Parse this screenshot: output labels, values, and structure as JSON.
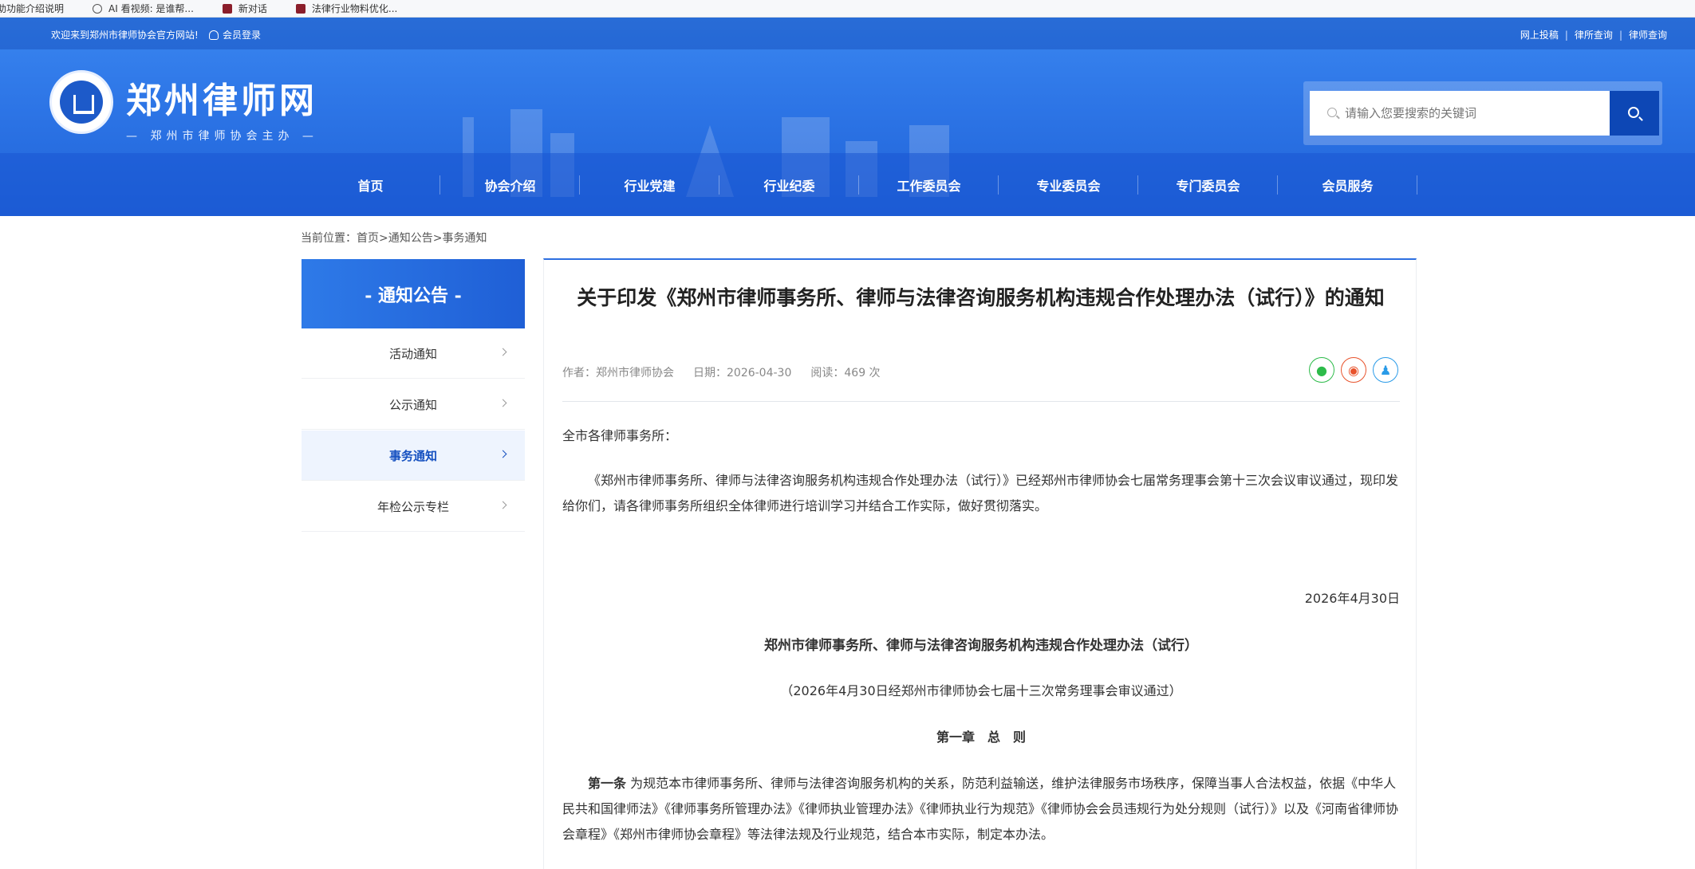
{
  "bookmarks": [
    {
      "label": "助功能介绍说明",
      "icon": "none"
    },
    {
      "label": "AI 看视频: 是谁帮...",
      "icon": "globe-icon"
    },
    {
      "label": "新对话",
      "icon": "site-favicon"
    },
    {
      "label": "法律行业物料优化...",
      "icon": "site-favicon"
    }
  ],
  "topbar": {
    "welcome": "欢迎来到郑州市律师协会官方网站!",
    "login": "会员登录",
    "links": [
      "网上投稿",
      "律所查询",
      "律师查询"
    ]
  },
  "brand": {
    "name": "郑州律师网",
    "subtitle": "— 郑州市律师协会主办 —"
  },
  "search": {
    "placeholder": "请输入您要搜索的关键词"
  },
  "nav": [
    "首页",
    "协会介绍",
    "行业党建",
    "行业纪委",
    "工作委员会",
    "专业委员会",
    "专门委员会",
    "会员服务"
  ],
  "breadcrumb": "当前位置：首页>通知公告>事务通知",
  "sidebar": {
    "title": "- 通知公告 -",
    "items": [
      {
        "label": "活动通知",
        "active": false
      },
      {
        "label": "公示通知",
        "active": false
      },
      {
        "label": "事务通知",
        "active": true
      },
      {
        "label": "年检公示专栏",
        "active": false
      }
    ]
  },
  "article": {
    "title": "关于印发《郑州市律师事务所、律师与法律咨询服务机构违规合作处理办法（试行）》的通知",
    "author": "作者：郑州市律师协会",
    "date": "日期：2026-04-30",
    "reads": "阅读：469 次",
    "share": [
      "wechat-icon",
      "weibo-icon",
      "qq-icon"
    ],
    "salutation": "全市各律师事务所：",
    "para1": "《郑州市律师事务所、律师与法律咨询服务机构违规合作处理办法（试行）》已经郑州市律师协会七届常务理事会第十三次会议审议通过，现印发给你们，请各律师事务所组织全体律师进行培训学习并结合工作实际，做好贯彻落实。",
    "sign_date": "2026年4月30日",
    "doc_title": "郑州市律师事务所、律师与法律咨询服务机构违规合作处理办法（试行）",
    "doc_note": "（2026年4月30日经郑州市律师协会七届十三次常务理事会审议通过）",
    "chapter": "第一章　总　则",
    "art1_label": "第一条",
    "art1_text": " 为规范本市律师事务所、律师与法律咨询服务机构的关系，防范利益输送，维护法律服务市场秩序，保障当事人合法权益，依据《中华人民共和国律师法》《律师事务所管理办法》《律师执业管理办法》《律师执业行为规范》《律师协会会员违规行为处分规则（试行）》以及《河南省律师协会章程》《郑州市律师协会章程》等法律法规及行业规范，结合本市实际，制定本办法。"
  }
}
